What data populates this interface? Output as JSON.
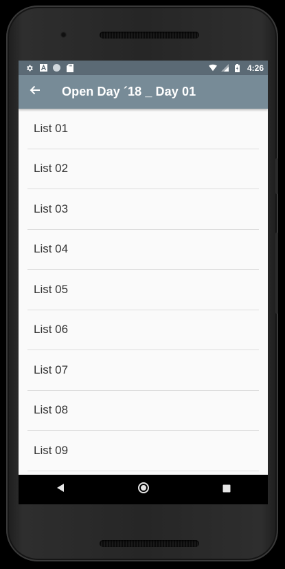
{
  "status_bar": {
    "time": "4:26",
    "icons": [
      "gear-icon",
      "a-icon",
      "circle-icon",
      "sd-card-icon",
      "wifi-icon",
      "signal-icon",
      "battery-charging-icon"
    ]
  },
  "app_bar": {
    "back_icon": "arrow-back-icon",
    "title": "Open Day ´18 _ Day 01",
    "background": "#778b97",
    "status_background": "#5b6a75"
  },
  "list": {
    "items": [
      {
        "label": "List 01"
      },
      {
        "label": "List 02"
      },
      {
        "label": "List 03"
      },
      {
        "label": "List 04"
      },
      {
        "label": "List 05"
      },
      {
        "label": "List 06"
      },
      {
        "label": "List 07"
      },
      {
        "label": "List 08"
      },
      {
        "label": "List 09"
      }
    ]
  },
  "nav_bar": {
    "buttons": [
      "back-triangle-icon",
      "home-circle-icon",
      "recents-square-icon"
    ]
  }
}
